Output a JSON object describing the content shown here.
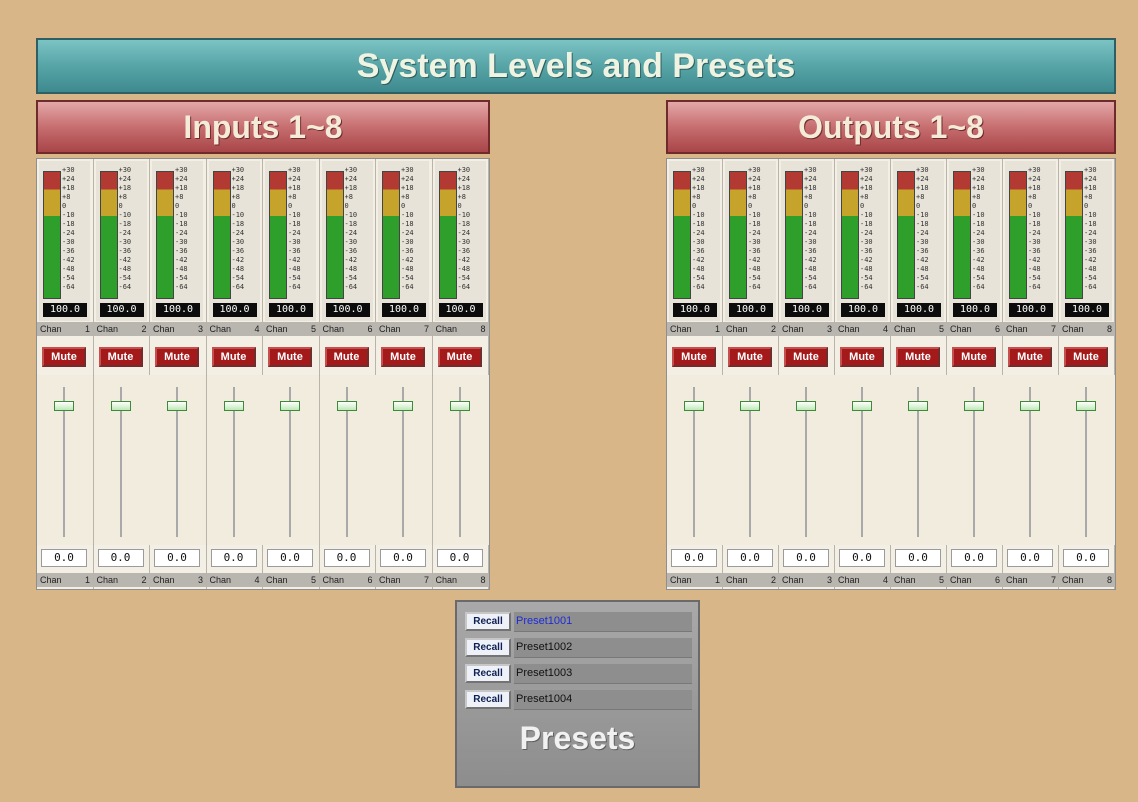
{
  "title": "System Levels and Presets",
  "inputs_header": "Inputs 1~8",
  "outputs_header": "Outputs 1~8",
  "meter_scale": [
    "+30",
    "+24",
    "+18",
    "+8",
    "0",
    "-10",
    "-18",
    "-24",
    "-30",
    "-36",
    "-42",
    "-48",
    "-54",
    "-64"
  ],
  "colors": {
    "meter_red": "#b23a32",
    "meter_yellow": "#c6a42c",
    "meter_green": "#2e9f2a",
    "mute": "#a4191a"
  },
  "inputs": [
    {
      "chan": "Chan",
      "num": "1",
      "meter": "100.0",
      "mute": "Mute",
      "fader": "0.0"
    },
    {
      "chan": "Chan",
      "num": "2",
      "meter": "100.0",
      "mute": "Mute",
      "fader": "0.0"
    },
    {
      "chan": "Chan",
      "num": "3",
      "meter": "100.0",
      "mute": "Mute",
      "fader": "0.0"
    },
    {
      "chan": "Chan",
      "num": "4",
      "meter": "100.0",
      "mute": "Mute",
      "fader": "0.0"
    },
    {
      "chan": "Chan",
      "num": "5",
      "meter": "100.0",
      "mute": "Mute",
      "fader": "0.0"
    },
    {
      "chan": "Chan",
      "num": "6",
      "meter": "100.0",
      "mute": "Mute",
      "fader": "0.0"
    },
    {
      "chan": "Chan",
      "num": "7",
      "meter": "100.0",
      "mute": "Mute",
      "fader": "0.0"
    },
    {
      "chan": "Chan",
      "num": "8",
      "meter": "100.0",
      "mute": "Mute",
      "fader": "0.0"
    }
  ],
  "outputs": [
    {
      "chan": "Chan",
      "num": "1",
      "meter": "100.0",
      "mute": "Mute",
      "fader": "0.0"
    },
    {
      "chan": "Chan",
      "num": "2",
      "meter": "100.0",
      "mute": "Mute",
      "fader": "0.0"
    },
    {
      "chan": "Chan",
      "num": "3",
      "meter": "100.0",
      "mute": "Mute",
      "fader": "0.0"
    },
    {
      "chan": "Chan",
      "num": "4",
      "meter": "100.0",
      "mute": "Mute",
      "fader": "0.0"
    },
    {
      "chan": "Chan",
      "num": "5",
      "meter": "100.0",
      "mute": "Mute",
      "fader": "0.0"
    },
    {
      "chan": "Chan",
      "num": "6",
      "meter": "100.0",
      "mute": "Mute",
      "fader": "0.0"
    },
    {
      "chan": "Chan",
      "num": "7",
      "meter": "100.0",
      "mute": "Mute",
      "fader": "0.0"
    },
    {
      "chan": "Chan",
      "num": "8",
      "meter": "100.0",
      "mute": "Mute",
      "fader": "0.0"
    }
  ],
  "presets": {
    "title": "Presets",
    "items": [
      {
        "button": "Recall",
        "name": "Preset1001",
        "active": true
      },
      {
        "button": "Recall",
        "name": "Preset1002",
        "active": false
      },
      {
        "button": "Recall",
        "name": "Preset1003",
        "active": false
      },
      {
        "button": "Recall",
        "name": "Preset1004",
        "active": false
      }
    ]
  }
}
